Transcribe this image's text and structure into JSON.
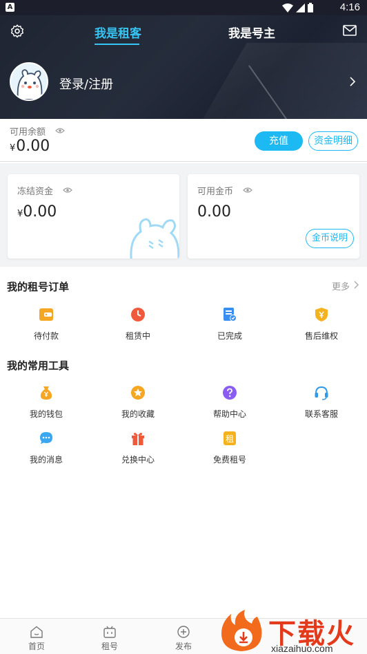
{
  "status_bar": {
    "app_badge": "A",
    "time": "4:16",
    "icons": [
      "wifi-icon",
      "signal-icon",
      "battery-icon"
    ]
  },
  "header": {
    "tabs": [
      {
        "label": "我是租客",
        "active": true
      },
      {
        "label": "我是号主",
        "active": false
      }
    ],
    "login_label": "登录/注册",
    "accent_color": "#35c6f4"
  },
  "balance": {
    "label": "可用余额",
    "currency": "¥",
    "amount": "0.00",
    "recharge_label": "充值",
    "detail_label": "资金明细"
  },
  "cards": {
    "frozen": {
      "label": "冻结资金",
      "currency": "¥",
      "amount": "0.00"
    },
    "coins": {
      "label": "可用金币",
      "amount": "0.00",
      "info_label": "金币说明"
    }
  },
  "orders": {
    "title": "我的租号订单",
    "more_label": "更多",
    "items": [
      {
        "label": "待付款",
        "icon": "wallet-icon",
        "color": "#f5a623"
      },
      {
        "label": "租赁中",
        "icon": "clock-icon",
        "color": "#f05a3c"
      },
      {
        "label": "已完成",
        "icon": "checklist-icon",
        "color": "#3a8ef0"
      },
      {
        "label": "售后维权",
        "icon": "shield-yen-icon",
        "color": "#f5b21f"
      }
    ]
  },
  "tools": {
    "title": "我的常用工具",
    "items": [
      {
        "label": "我的钱包",
        "icon": "money-bag-icon",
        "color": "#f5a623"
      },
      {
        "label": "我的收藏",
        "icon": "star-icon",
        "color": "#f5a623"
      },
      {
        "label": "帮助中心",
        "icon": "question-icon",
        "color": "#8a5cf0"
      },
      {
        "label": "联系客服",
        "icon": "headset-icon",
        "color": "#2f9be8"
      },
      {
        "label": "我的消息",
        "icon": "message-icon",
        "color": "#3aa7f0"
      },
      {
        "label": "兑换中心",
        "icon": "gift-icon",
        "color": "#f05a3c"
      },
      {
        "label": "免费租号",
        "icon": "rent-tag-icon",
        "color": "#f5b21f",
        "glyph": "租"
      }
    ]
  },
  "bottom_nav": [
    {
      "label": "首页",
      "icon": "home-icon"
    },
    {
      "label": "租号",
      "icon": "gamepad-icon"
    },
    {
      "label": "发布",
      "icon": "plus-circle-icon"
    }
  ],
  "watermark": {
    "brand": "下载火",
    "url": "xiazaihuo.com"
  }
}
